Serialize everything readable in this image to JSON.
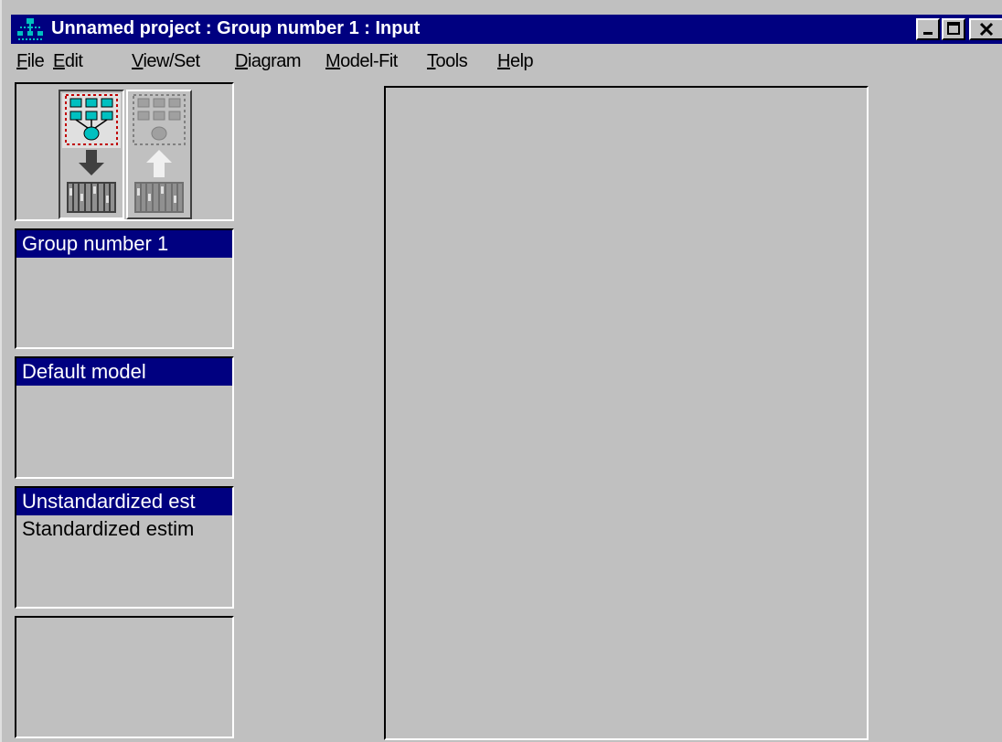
{
  "window": {
    "title": "Unnamed project : Group number 1 : Input",
    "title_color": "#000080"
  },
  "menu": [
    {
      "label": "File",
      "accel": "F",
      "rest": "ile"
    },
    {
      "label": "Edit",
      "accel": "E",
      "rest": "dit"
    },
    {
      "label": "View/Set",
      "accel": "V",
      "rest": "iew/Set"
    },
    {
      "label": "Diagram",
      "accel": "D",
      "rest": "iagram"
    },
    {
      "label": "Model-Fit",
      "accel": "M",
      "rest": "odel-Fit"
    },
    {
      "label": "Tools",
      "accel": "T",
      "rest": "ools"
    },
    {
      "label": "Help",
      "accel": "H",
      "rest": "elp"
    }
  ],
  "toolbar": {
    "input_view_icon": "path-diagram-input-icon",
    "output_view_icon": "path-diagram-output-icon"
  },
  "groups_panel": {
    "items": [
      {
        "label": "Group number 1",
        "selected": true
      }
    ]
  },
  "models_panel": {
    "items": [
      {
        "label": "Default model",
        "selected": true
      }
    ]
  },
  "estimates_panel": {
    "items": [
      {
        "label": "Unstandardized est",
        "selected": true
      },
      {
        "label": "Standardized estim",
        "selected": false
      }
    ]
  },
  "extra_panel": {
    "items": []
  }
}
